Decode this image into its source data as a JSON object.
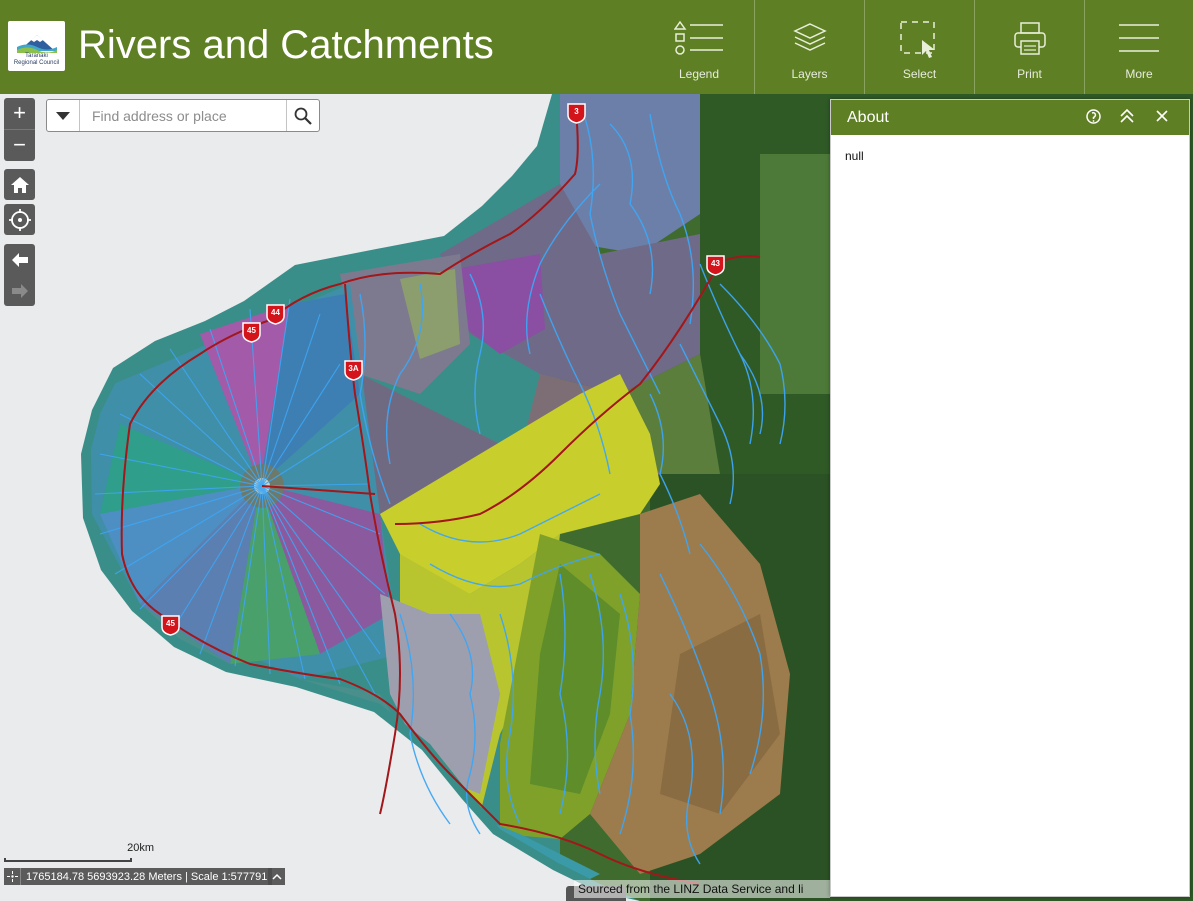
{
  "app": {
    "title": "Rivers and Catchments",
    "logo_text": "Taranaki\nRegional Council",
    "brand_color": "#5e7f23"
  },
  "toolbar": {
    "items": [
      {
        "label": "Legend",
        "icon": "legend-icon"
      },
      {
        "label": "Layers",
        "icon": "layers-icon"
      },
      {
        "label": "Select",
        "icon": "select-icon"
      },
      {
        "label": "Print",
        "icon": "print-icon"
      },
      {
        "label": "More",
        "icon": "menu-icon"
      }
    ]
  },
  "map_controls": {
    "zoom_in": "+",
    "zoom_out": "−",
    "home_icon": "home-icon",
    "locate_icon": "locate-icon",
    "back_icon": "arrow-left-icon",
    "forward_icon": "arrow-right-icon"
  },
  "search": {
    "placeholder": "Find address or place",
    "value": ""
  },
  "highway_shields": [
    "3",
    "43",
    "44",
    "45",
    "3A",
    "45"
  ],
  "scale": {
    "label": "20km"
  },
  "coordinates": {
    "text": "1765184.78 5693923.28 Meters | Scale 1:577791"
  },
  "attribution": "Sourced from the LINZ Data Service and li",
  "about_panel": {
    "title": "About",
    "body": "null"
  }
}
